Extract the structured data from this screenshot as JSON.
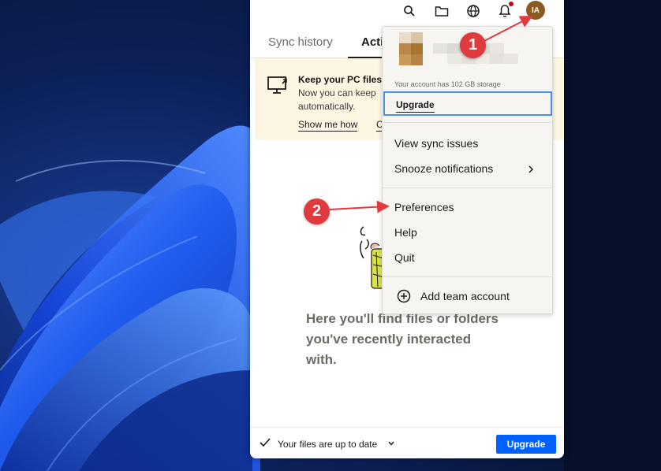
{
  "topbar": {
    "avatar_initials": "IA"
  },
  "tabs": [
    {
      "label": "Sync history"
    },
    {
      "label": "Acti"
    }
  ],
  "banner": {
    "title": "Keep your PC files",
    "line1": "Now you can keep",
    "line2": "automatically.",
    "show_link": "Show me how",
    "other_link": "C"
  },
  "empty_state": {
    "line1": "Here you'll find files or folders",
    "line2": "you've recently interacted",
    "line3": "with."
  },
  "statusbar": {
    "status": "Your files are up to date",
    "upgrade_label": "Upgrade"
  },
  "menu": {
    "storage_text": "Your account has 102 GB storage",
    "upgrade_label": "Upgrade",
    "items": [
      {
        "label": "View sync issues"
      },
      {
        "label": "Snooze notifications"
      },
      {
        "label": "Preferences"
      },
      {
        "label": "Help"
      },
      {
        "label": "Quit"
      },
      {
        "label": "Add team account"
      }
    ]
  },
  "annotations": {
    "step1": "1",
    "step2": "2"
  },
  "colors": {
    "accent_blue": "#0061fe",
    "focus_outline": "#4a90e2",
    "annotation_red": "#e0393e",
    "banner_bg": "#fdf6e3",
    "avatar_bg": "#8b5a1e"
  },
  "icons": [
    "search-icon",
    "folder-icon",
    "globe-icon",
    "bell-icon",
    "monitor-sync-icon",
    "checkmark-icon",
    "chevron-down-icon",
    "chevron-right-icon",
    "plus-circle-icon"
  ]
}
